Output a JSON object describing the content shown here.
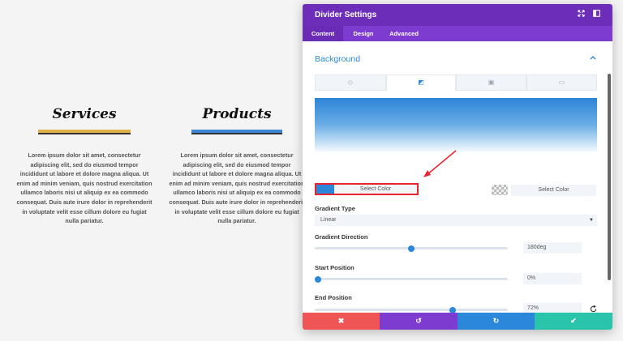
{
  "page": {
    "columns": [
      {
        "title": "Services",
        "text": "Lorem ipsum dolor sit amet, consectetur adipiscing elit, sed do eiusmod tempor incididunt ut labore et dolore magna aliqua. Ut enim ad minim veniam, quis nostrud exercitation ullamco laboris nisi ut aliquip ex ea commodo consequat. Duis aute irure dolor in reprehenderit in voluptate velit esse cillum dolore eu fugiat nulla pariatur."
      },
      {
        "title": "Products",
        "text": "Lorem ipsum dolor sit amet, consectetur adipiscing elit, sed do eiusmod tempor incididunt ut labore et dolore magna aliqua. Ut enim ad minim veniam, quis nostrud exercitation ullamco laboris nisi ut aliquip ex ea commodo consequat. Duis aute irure dolor in reprehenderit in voluptate velit esse cillum dolore eu fugiat nulla pariatur."
      }
    ]
  },
  "modal": {
    "title": "Divider Settings",
    "tabs": [
      {
        "label": "Content",
        "active": true
      },
      {
        "label": "Design",
        "active": false
      },
      {
        "label": "Advanced",
        "active": false
      }
    ],
    "section": {
      "title": "Background"
    },
    "bg_tabs": [
      {
        "icon": "paint-bucket-icon",
        "glyph": "◇",
        "active": false
      },
      {
        "icon": "gradient-icon",
        "glyph": "◩",
        "active": true
      },
      {
        "icon": "image-icon",
        "glyph": "▣",
        "active": false
      },
      {
        "icon": "video-icon",
        "glyph": "▭",
        "active": false
      }
    ],
    "gradient": {
      "start_color": "#2b87da",
      "end_color": "#ffffff",
      "start_select_label": "Select Color",
      "end_select_label": "Select Color"
    },
    "fields": {
      "gradient_type": {
        "label": "Gradient Type",
        "value": "Linear"
      },
      "gradient_direction": {
        "label": "Gradient Direction",
        "value": "180deg",
        "fraction": 0.5
      },
      "start_position": {
        "label": "Start Position",
        "value": "0%",
        "fraction": 0.0
      },
      "end_position": {
        "label": "End Position",
        "value": "72%",
        "fraction": 0.72
      }
    },
    "footer": {
      "cancel_glyph": "✖",
      "undo_glyph": "↺",
      "redo_glyph": "↻",
      "save_glyph": "✔"
    }
  },
  "colors": {
    "header": "#6c2eb9",
    "tabs": "#7d3bd0",
    "accent": "#2b87da",
    "cancel": "#ef5555",
    "undo": "#7e3bd0",
    "redo": "#2b87da",
    "save": "#29c4a9",
    "highlight": "#e8242e"
  }
}
